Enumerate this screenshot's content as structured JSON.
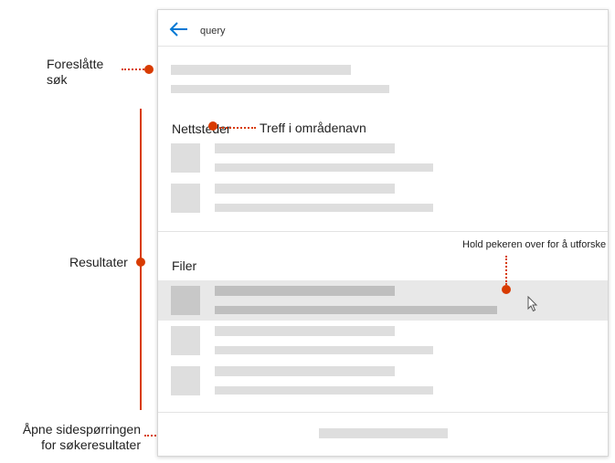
{
  "search": {
    "query": "query"
  },
  "sections": {
    "sites_heading": "Nettsteder",
    "files_heading": "Filer"
  },
  "annotations": {
    "suggested": "Foreslåtte\nsøk",
    "results": "Resultater",
    "site_name_match": "Treff i områdenavn",
    "hover_explore": "Hold pekeren over for å utforske",
    "open_results_page": "Åpne sidespørringen\nfor søkeresultater"
  },
  "colors": {
    "accent": "#d83b01",
    "back_arrow": "#0078d4",
    "placeholder": "#dedede"
  },
  "icons": {
    "back": "arrow-left-icon",
    "cursor": "mouse-pointer-icon"
  }
}
